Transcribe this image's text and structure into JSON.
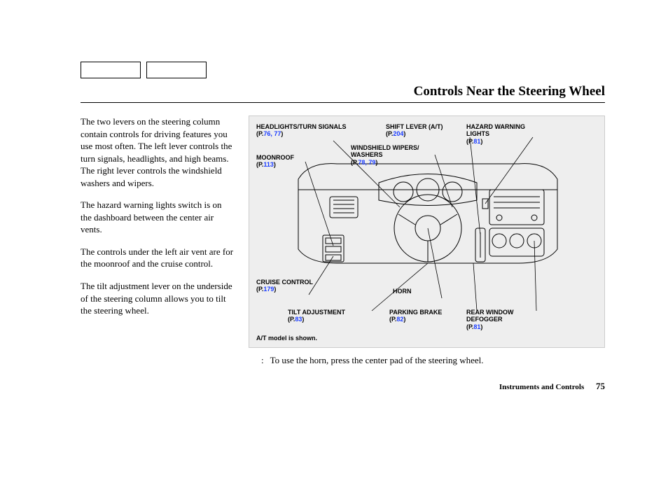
{
  "title": "Controls Near the Steering Wheel",
  "body": {
    "p1": "The two levers on the steering column contain controls for driving features you use most often. The left lever controls the turn signals, headlights, and high beams. The right lever controls the windshield washers and wipers.",
    "p2": "The hazard warning lights switch is on the dashboard between the center air vents.",
    "p3": "The controls under the left air vent are for the moonroof and the cruise control.",
    "p4": "The tilt adjustment lever on the underside of the steering column allows you to tilt the steering wheel."
  },
  "labels": {
    "headlights": {
      "t": "HEADLIGHTS/TURN SIGNALS",
      "p": "76, 77"
    },
    "moonroof": {
      "t": "MOONROOF",
      "p": "113"
    },
    "wipers": {
      "t": "WINDSHIELD WIPERS/\nWASHERS",
      "p": "78, 79"
    },
    "shift": {
      "t": "SHIFT LEVER (A/T)",
      "p": "204"
    },
    "hazard": {
      "t": "HAZARD WARNING\nLIGHTS",
      "p": "81"
    },
    "cruise": {
      "t": "CRUISE CONTROL",
      "p": "179"
    },
    "tilt": {
      "t": "TILT ADJUSTMENT",
      "p": "83"
    },
    "horn": {
      "t": "HORN",
      "p": ""
    },
    "parking": {
      "t": "PARKING BRAKE",
      "p": "82"
    },
    "rear": {
      "t": "REAR WINDOW\nDEFOGGER",
      "p": "81"
    }
  },
  "fig_note": "A/T model is shown.",
  "caption_lead": ":",
  "caption": "To use the horn, press the center pad of the steering wheel.",
  "footer_section": "Instruments and Controls",
  "footer_page": "75",
  "page_prefix": "P."
}
